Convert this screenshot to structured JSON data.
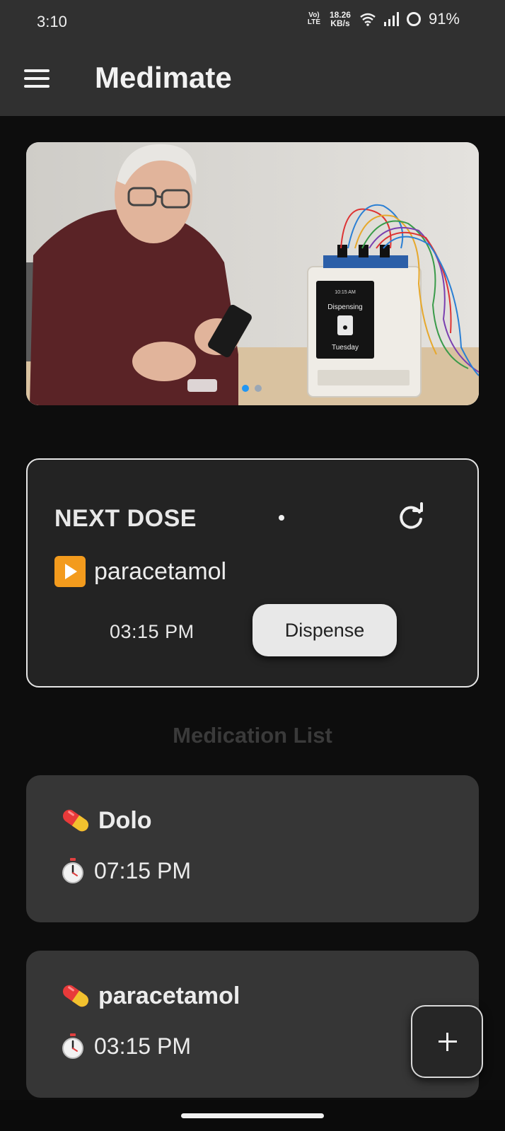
{
  "status_bar": {
    "time": "3:10",
    "volte_label": "Vo) LTE",
    "net_speed": "18.26",
    "net_speed_unit": "KB/s",
    "battery": "91%"
  },
  "app_bar": {
    "title": "Medimate"
  },
  "banner": {
    "device_time": "10:15 AM",
    "device_status": "Dispensing",
    "device_day": "Tuesday",
    "carousel_page": 1,
    "carousel_count": 2
  },
  "next_dose": {
    "title": "NEXT DOSE",
    "medication": "paracetamol",
    "time": "03:15 PM",
    "dispense_label": "Dispense"
  },
  "medication_list": {
    "title": "Medication List",
    "items": [
      {
        "name": "Dolo",
        "time": "07:15 PM"
      },
      {
        "name": "paracetamol",
        "time": "03:15 PM"
      }
    ]
  },
  "colors": {
    "accent_active_dot": "#2196f3",
    "play_icon": "#f39b1d",
    "card_background": "#363636",
    "background": "#0d0d0d"
  },
  "icons": {
    "menu": "menu-icon",
    "refresh": "refresh-icon",
    "play": "play-icon",
    "pill": "pill-icon",
    "stopwatch": "stopwatch-icon",
    "add": "plus-icon"
  }
}
